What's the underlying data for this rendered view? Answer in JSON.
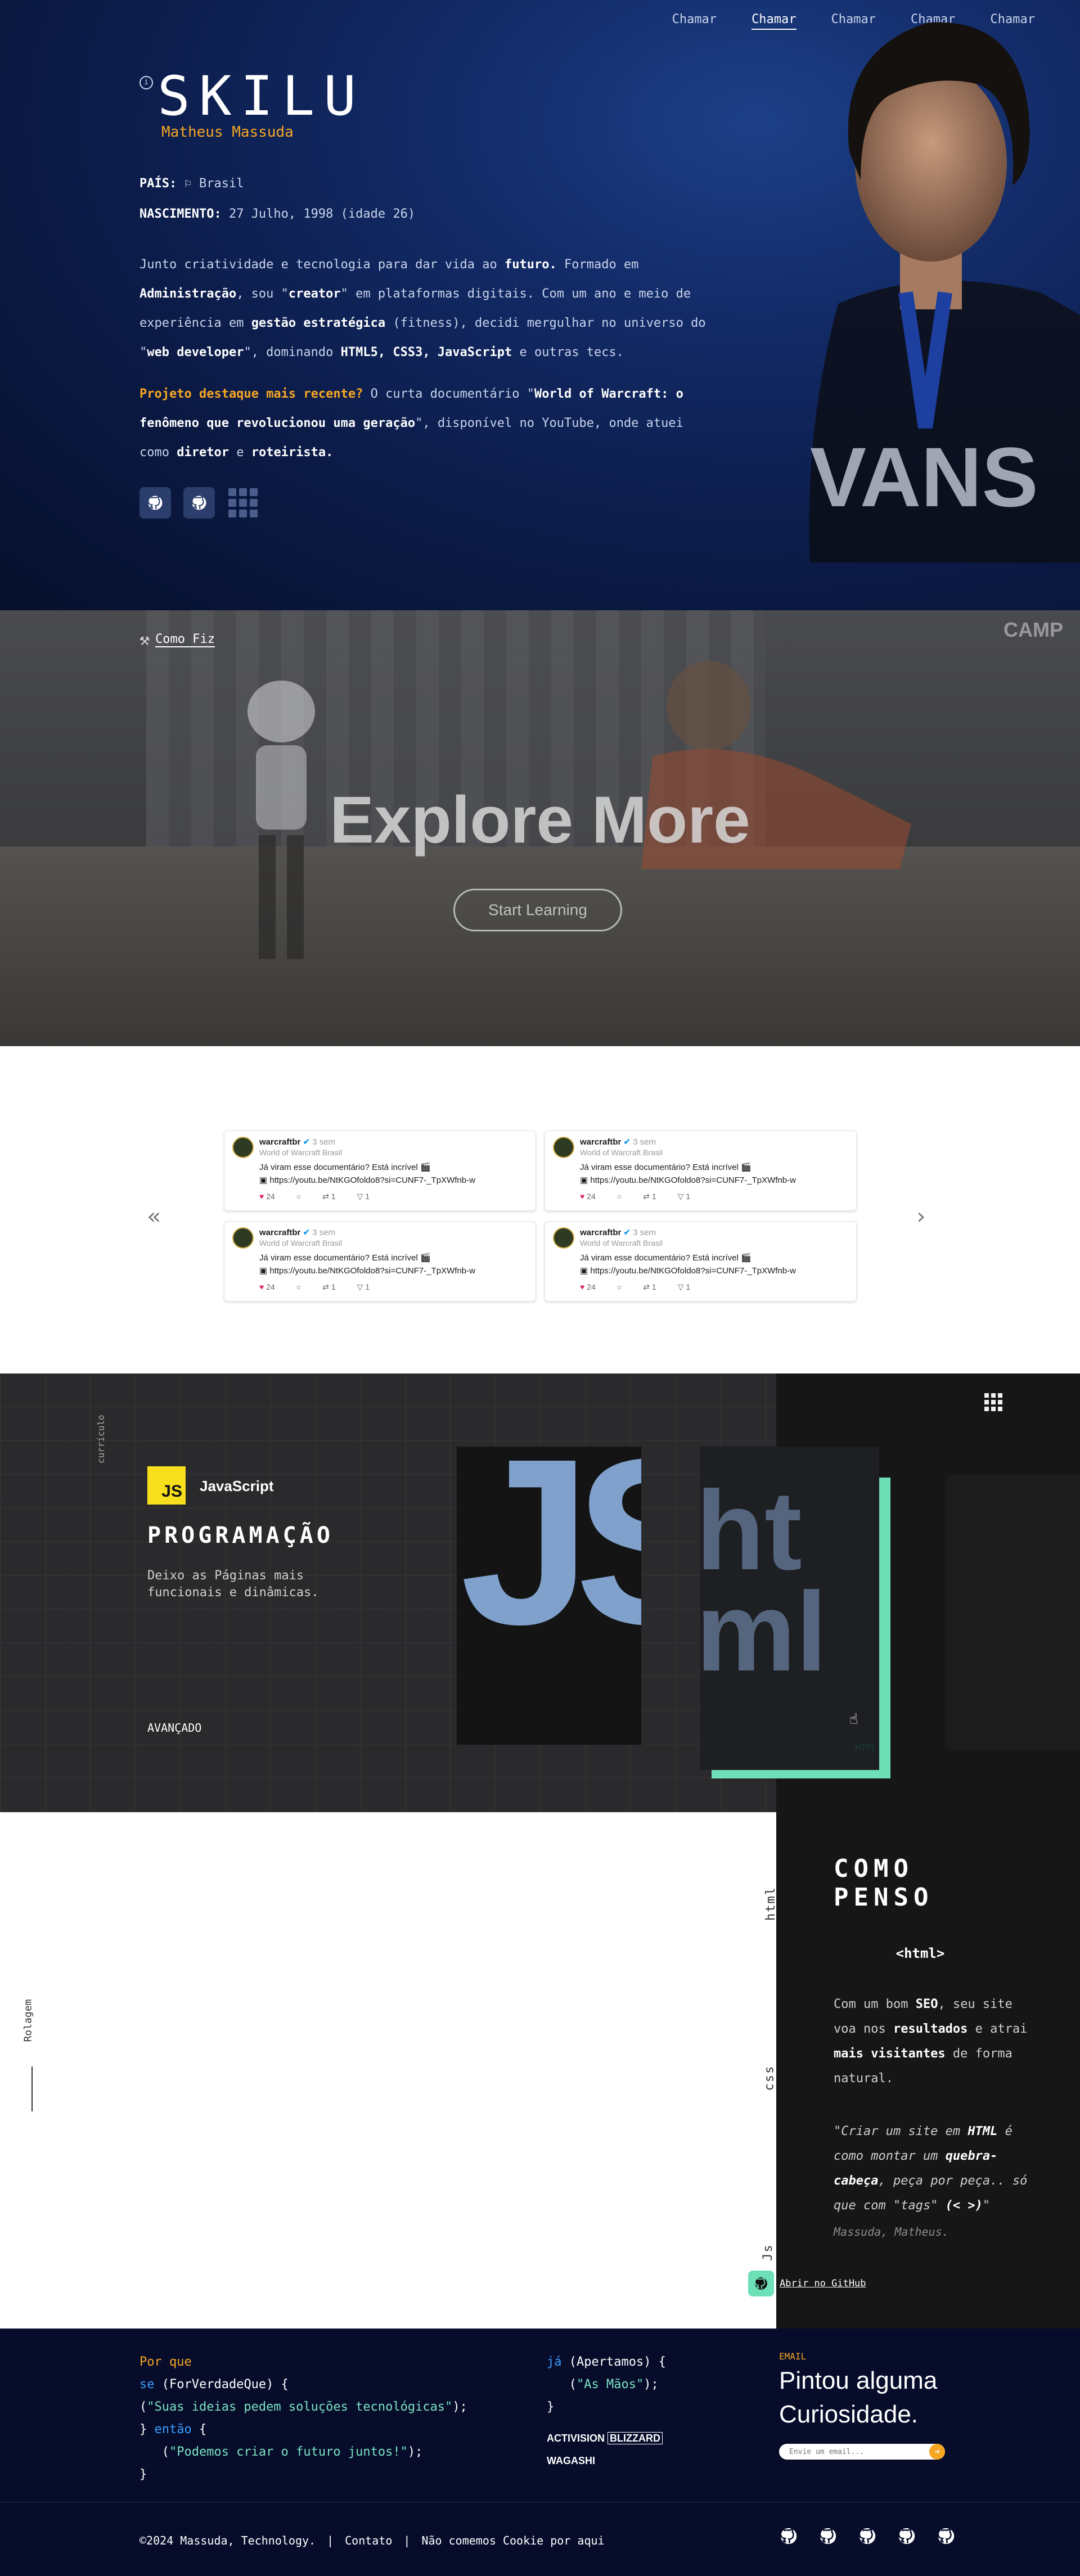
{
  "nav": {
    "items": [
      "Chamar",
      "Chamar",
      "Chamar",
      "Chamar",
      "Chamar"
    ]
  },
  "hero": {
    "brand": "SKILU",
    "subtitle": "Matheus Massuda",
    "country_label": "PAÍS:",
    "country_value": "Brasil",
    "birth_label": "NASCIMENTO:",
    "birth_value": "27 Julho, 1998 (idade 26)",
    "bio_p1_a": "Junto criatividade e tecnologia para dar vida ao ",
    "bio_p1_b": "futuro.",
    "bio_p1_c": " Formado em ",
    "bio_p1_d": "Administração",
    "bio_p1_e": ", sou \"",
    "bio_p1_f": "creator",
    "bio_p1_g": "\" em plataformas digitais. Com um ano e meio de experiência em ",
    "bio_p1_h": "gestão estratégica",
    "bio_p1_i": " (fitness), decidi mergulhar no universo do \"",
    "bio_p1_j": "web developer",
    "bio_p1_k": "\", dominando ",
    "bio_p1_l": "HTML5, CSS3, JavaScript",
    "bio_p1_m": " e outras tecs.",
    "bio_p2_a": "Projeto destaque mais recente?",
    "bio_p2_b": " O curta documentário \"",
    "bio_p2_c": "World of Warcraft: o fenômeno que revolucionou uma geração",
    "bio_p2_d": "\", disponível no YouTube, onde atuei como ",
    "bio_p2_e": "diretor",
    "bio_p2_f": " e ",
    "bio_p2_g": "roteirista."
  },
  "explore": {
    "howto": "Como Fiz",
    "corner": "CAMP",
    "title": "Explore More",
    "button": "Start Learning"
  },
  "tweets": {
    "items": [
      {
        "name": "warcraftbr",
        "time": "3 sem",
        "sub": "World of Warcraft Brasil",
        "text": "Já viram esse documentário? Está incrível 🎬",
        "url": "https://youtu.be/NtKGOfoldo8?si=CUNF7-_TpXWfnb-w",
        "likes": "24",
        "replies": "",
        "rts": "1",
        "shares": "1"
      },
      {
        "name": "warcraftbr",
        "time": "3 sem",
        "sub": "World of Warcraft Brasil",
        "text": "Já viram esse documentário? Está incrível 🎬",
        "url": "https://youtu.be/NtKGOfoldo8?si=CUNF7-_TpXWfnb-w",
        "likes": "24",
        "replies": "",
        "rts": "1",
        "shares": "1"
      },
      {
        "name": "warcraftbr",
        "time": "3 sem",
        "sub": "World of Warcraft Brasil",
        "text": "Já viram esse documentário? Está incrível 🎬",
        "url": "https://youtu.be/NtKGOfoldo8?si=CUNF7-_TpXWfnb-w",
        "likes": "24",
        "replies": "",
        "rts": "1",
        "shares": "1"
      },
      {
        "name": "warcraftbr",
        "time": "3 sem",
        "sub": "World of Warcraft Brasil",
        "text": "Já viram esse documentário? Está incrível 🎬",
        "url": "https://youtu.be/NtKGOfoldo8?si=CUNF7-_TpXWfnb-w",
        "likes": "24",
        "replies": "",
        "rts": "1",
        "shares": "1"
      }
    ]
  },
  "prog": {
    "vertical": "currículo",
    "badge": "JS",
    "lang": "JavaScript",
    "heading": "PROGRAMAÇÃO",
    "desc": "Deixo as Páginas mais funcionais e dinâmicas.",
    "level": "AVANÇADO",
    "card_js_text": "JS",
    "card_html_line1": "ht",
    "card_html_line2": "ml",
    "card_html_label": "HTML"
  },
  "think": {
    "left_label": "Rolagem",
    "tabs": [
      "html",
      "css",
      "Js"
    ],
    "title": "COMO PENSO",
    "tag": "<html>",
    "p_a": "Com um bom ",
    "p_b": "SEO",
    "p_c": ", seu site voa nos ",
    "p_d": "resultados",
    "p_e": " e atrai ",
    "p_f": "mais visitantes",
    "p_g": " de forma natural.",
    "q_a": "\"Criar um site em ",
    "q_b": "HTML",
    "q_c": " é como montar um ",
    "q_d": "quebra-cabeça",
    "q_e": ", peça por peça.. só que com \"tags\" ",
    "q_f": "(< >)",
    "q_g": "\"",
    "author": "Massuda, Matheus.",
    "github": "Abrir no GitHub"
  },
  "footer": {
    "c1_l1": "Por que",
    "c1_l2_a": "se",
    "c1_l2_b": " (ForVerdadeQue) {",
    "c1_l3_a": " (",
    "c1_l3_b": "\"Suas ideias pedem soluções tecnológicas\"",
    "c1_l3_c": ");",
    "c1_l4_a": "} ",
    "c1_l4_b": "então",
    "c1_l4_c": " {",
    "c1_l5_a": "   (",
    "c1_l5_b": "\"Podemos criar o futuro juntos!\"",
    "c1_l5_c": ");",
    "c1_l6": "}",
    "c2_l1_a": "já",
    "c2_l1_b": " (Apertamos) {",
    "c2_l2_a": "   (",
    "c2_l2_b": "\"As Mãos\"",
    "c2_l2_c": ");",
    "c2_l3": "}",
    "logo1": "ACTIVISION",
    "logo2": "BLIZZARD",
    "logo3": "WAGASHI",
    "nl_label": "EMAIL",
    "nl_title": "Pintou alguma Curiosidade.",
    "nl_placeholder": "Envie um email...",
    "copyright": "©2024 Massuda, Technology.",
    "contact": "Contato",
    "cookie": "Não comemos Cookie por aqui"
  },
  "colors": {
    "accent": "#f6a623",
    "mint": "#6ee0b7",
    "navy": "#060c2a",
    "js": "#f7df1e"
  }
}
